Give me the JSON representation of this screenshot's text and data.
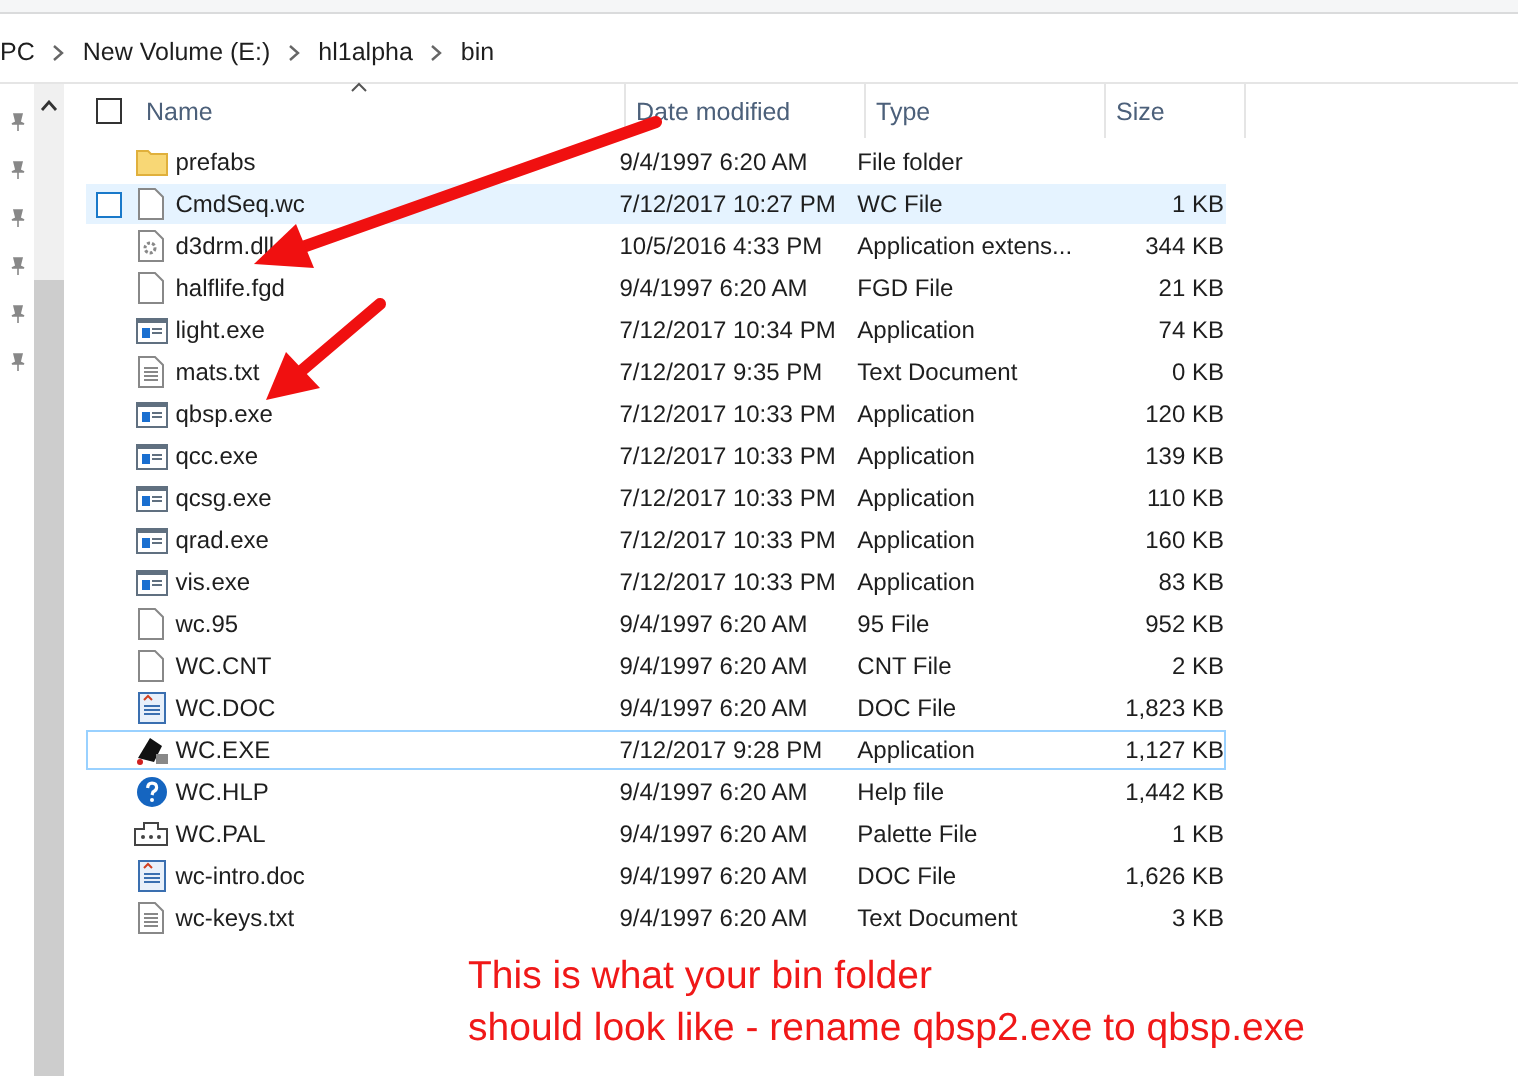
{
  "select_all_checked": false,
  "breadcrumb": [
    "PC",
    "New Volume (E:)",
    "hl1alpha",
    "bin"
  ],
  "columns": [
    {
      "label": "Name",
      "sorted": true
    },
    {
      "label": "Date modified",
      "sorted": false
    },
    {
      "label": "Type",
      "sorted": false
    },
    {
      "label": "Size",
      "sorted": false
    }
  ],
  "files": [
    {
      "name": "prefabs",
      "date": "9/4/1997 6:20 AM",
      "type": "File folder",
      "kind": "folder",
      "hovered": false,
      "focused": false
    },
    {
      "name": "CmdSeq.wc",
      "date": "7/12/2017 10:27 PM",
      "type": "WC File",
      "size": "1 KB",
      "kind": "blank",
      "hovered": true,
      "focused": false
    },
    {
      "name": "d3drm.dll",
      "date": "10/5/2016 4:33 PM",
      "type": "Application extens...",
      "size": "344 KB",
      "kind": "dll",
      "hovered": false,
      "focused": false
    },
    {
      "name": "halflife.fgd",
      "date": "9/4/1997 6:20 AM",
      "type": "FGD File",
      "size": "21 KB",
      "kind": "blank",
      "hovered": false,
      "focused": false
    },
    {
      "name": "light.exe",
      "date": "7/12/2017 10:34 PM",
      "type": "Application",
      "size": "74 KB",
      "kind": "app",
      "hovered": false,
      "focused": false
    },
    {
      "name": "mats.txt",
      "date": "7/12/2017 9:35 PM",
      "type": "Text Document",
      "size": "0 KB",
      "kind": "text",
      "hovered": false,
      "focused": false
    },
    {
      "name": "qbsp.exe",
      "date": "7/12/2017 10:33 PM",
      "type": "Application",
      "size": "120 KB",
      "kind": "app",
      "hovered": false,
      "focused": false
    },
    {
      "name": "qcc.exe",
      "date": "7/12/2017 10:33 PM",
      "type": "Application",
      "size": "139 KB",
      "kind": "app",
      "hovered": false,
      "focused": false
    },
    {
      "name": "qcsg.exe",
      "date": "7/12/2017 10:33 PM",
      "type": "Application",
      "size": "110 KB",
      "kind": "app",
      "hovered": false,
      "focused": false
    },
    {
      "name": "qrad.exe",
      "date": "7/12/2017 10:33 PM",
      "type": "Application",
      "size": "160 KB",
      "kind": "app",
      "hovered": false,
      "focused": false
    },
    {
      "name": "vis.exe",
      "date": "7/12/2017 10:33 PM",
      "type": "Application",
      "size": "83 KB",
      "kind": "app",
      "hovered": false,
      "focused": false
    },
    {
      "name": "wc.95",
      "date": "9/4/1997 6:20 AM",
      "type": "95 File",
      "size": "952 KB",
      "kind": "blank",
      "hovered": false,
      "focused": false
    },
    {
      "name": "WC.CNT",
      "date": "9/4/1997 6:20 AM",
      "type": "CNT File",
      "size": "2 KB",
      "kind": "blank",
      "hovered": false,
      "focused": false
    },
    {
      "name": "WC.DOC",
      "date": "9/4/1997 6:20 AM",
      "type": "DOC File",
      "size": "1,823 KB",
      "kind": "doc",
      "hovered": false,
      "focused": false
    },
    {
      "name": "WC.EXE",
      "date": "7/12/2017 9:28 PM",
      "type": "Application",
      "size": "1,127 KB",
      "kind": "wcexe",
      "hovered": false,
      "focused": true
    },
    {
      "name": "WC.HLP",
      "date": "9/4/1997 6:20 AM",
      "type": "Help file",
      "size": "1,442 KB",
      "kind": "help",
      "hovered": false,
      "focused": false
    },
    {
      "name": "WC.PAL",
      "date": "9/4/1997 6:20 AM",
      "type": "Palette File",
      "size": "1 KB",
      "kind": "palette",
      "hovered": false,
      "focused": false
    },
    {
      "name": "wc-intro.doc",
      "date": "9/4/1997 6:20 AM",
      "type": "DOC File",
      "size": "1,626 KB",
      "kind": "doc",
      "hovered": false,
      "focused": false
    },
    {
      "name": "wc-keys.txt",
      "date": "9/4/1997 6:20 AM",
      "type": "Text Document",
      "size": "3 KB",
      "kind": "text",
      "hovered": false,
      "focused": false
    }
  ],
  "annotation": {
    "lines": [
      "This is what your bin folder",
      "should look like - rename qbsp2.exe to qbsp.exe"
    ]
  }
}
